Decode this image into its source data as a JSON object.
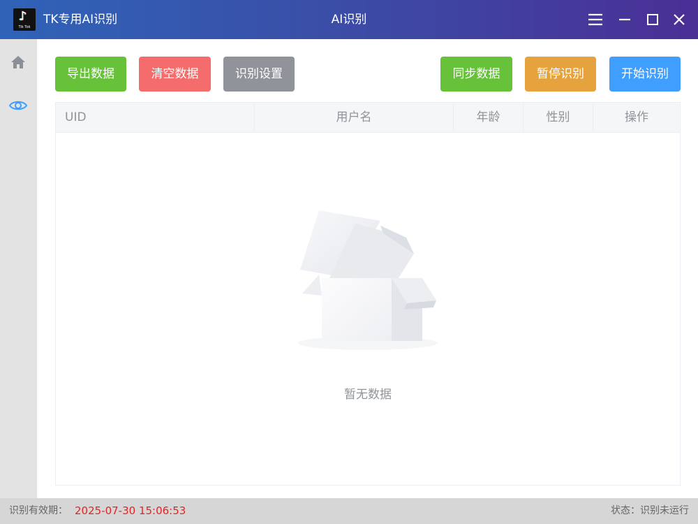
{
  "app": {
    "title": "TK专用AI识别",
    "window_title": "AI识别",
    "logo_caption": "Tik Tok"
  },
  "toolbar": {
    "export_label": "导出数据",
    "clear_label": "清空数据",
    "settings_label": "识别设置",
    "sync_label": "同步数据",
    "pause_label": "暂停识别",
    "start_label": "开始识别"
  },
  "table": {
    "columns": [
      "UID",
      "用户名",
      "年龄",
      "性别",
      "操作"
    ],
    "empty_text": "暂无数据"
  },
  "status": {
    "validity_label": "识别有效期：",
    "validity_date": "2025-07-30 15:06:53",
    "state_text": "状态：识别未运行"
  },
  "colors": {
    "export": "#67c23a",
    "clear": "#f56c6c",
    "settings": "#909399",
    "sync": "#67c23a",
    "pause": "#e6a23c",
    "start": "#409eff",
    "date": "#e02424"
  },
  "icons": {
    "sidebar": [
      "home-icon",
      "eye-icon"
    ],
    "window": [
      "menu-icon",
      "minimize-icon",
      "maximize-icon",
      "close-icon"
    ]
  }
}
